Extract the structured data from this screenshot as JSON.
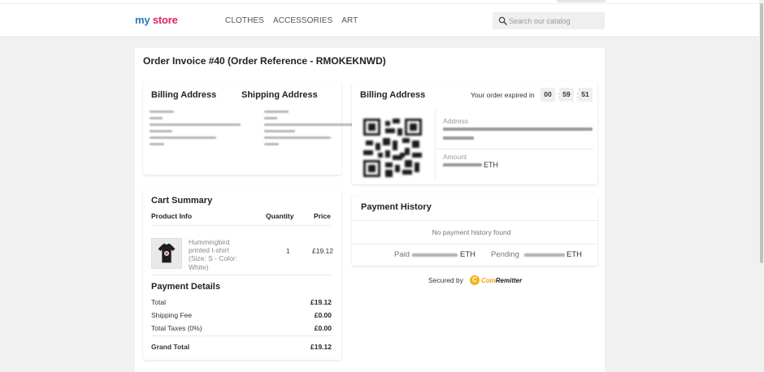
{
  "header": {
    "logo": {
      "part1": "my",
      "part2": "store"
    },
    "nav": [
      "CLOTHES",
      "ACCESSORIES",
      "ART"
    ],
    "search": {
      "placeholder": "Search our catalog"
    }
  },
  "invoice": {
    "title": "Order Invoice #40 (Order Reference - RMOKEKNWD)"
  },
  "addresses": {
    "billing_title": "Billing Address",
    "shipping_title": "Shipping Address"
  },
  "payment": {
    "title": "Billing Address",
    "timer_label": "Your order expired in",
    "timer": {
      "hours": "00",
      "minutes": "59",
      "seconds": "51",
      "sep": ":"
    },
    "address_label": "Address",
    "amount_label": "Amount",
    "amount_currency": "ETH"
  },
  "cart": {
    "title": "Cart Summary",
    "headers": {
      "product": "Product Info",
      "quantity": "Quantity",
      "price": "Price"
    },
    "items": [
      {
        "name": "Hummingbird printed t-shirt (Size: S - Color: White)",
        "quantity": "1",
        "price": "£19.12"
      }
    ]
  },
  "payment_details": {
    "title": "Payment Details",
    "rows": [
      {
        "label": "Total",
        "value": "£19.12"
      },
      {
        "label": "Shipping Fee",
        "value": "£0.00"
      },
      {
        "label": "Total Taxes (0%)",
        "value": "£0.00"
      }
    ],
    "grand": {
      "label": "Grand Total",
      "value": "£19.12"
    }
  },
  "history": {
    "title": "Payment History",
    "empty": "No payment history found",
    "paid_label": "Paid",
    "pending_label": "Pending",
    "currency": "ETH"
  },
  "footer": {
    "secured_by": "Secured by",
    "brand_coin": "Coin",
    "brand_rest": "Remitter",
    "brand_mark": "C"
  },
  "colors": {
    "logo_blue": "#2b7bb9",
    "logo_pink": "#e0245e",
    "coinremitter_gold": "#f2b418"
  }
}
